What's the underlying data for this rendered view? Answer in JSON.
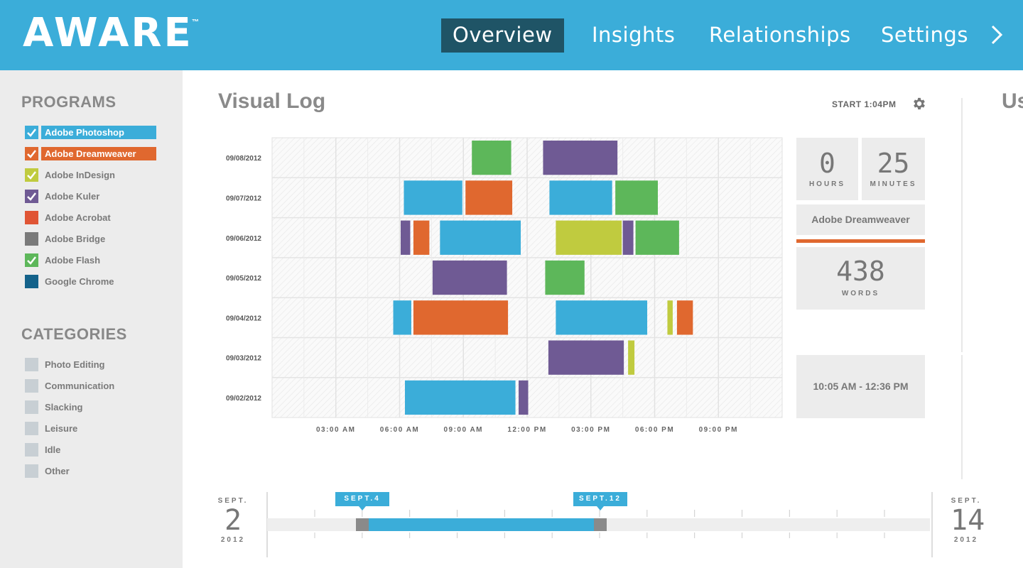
{
  "app": {
    "logo": "AWARE",
    "trademark": "™"
  },
  "nav": [
    {
      "label": "Overview",
      "active": true
    },
    {
      "label": "Insights",
      "active": false
    },
    {
      "label": "Relationships",
      "active": false
    },
    {
      "label": "Settings",
      "active": false
    }
  ],
  "nav_more_icon": "chevron-right-icon",
  "sidebar": {
    "programs_heading": "PROGRAMS",
    "programs": [
      {
        "label": "Adobe Photoshop",
        "color": "#3badd9",
        "checked": true,
        "highlighted": true
      },
      {
        "label": "Adobe Dreamweaver",
        "color": "#e0682f",
        "checked": true,
        "highlighted": true
      },
      {
        "label": "Adobe InDesign",
        "color": "#c0cb3f",
        "checked": true,
        "highlighted": false
      },
      {
        "label": "Adobe Kuler",
        "color": "#6f5a94",
        "checked": true,
        "highlighted": false
      },
      {
        "label": "Adobe Acrobat",
        "color": "#e05535",
        "checked": false,
        "highlighted": false
      },
      {
        "label": "Adobe Bridge",
        "color": "#7a7a7a",
        "checked": false,
        "highlighted": false
      },
      {
        "label": "Adobe Flash",
        "color": "#5db75a",
        "checked": true,
        "highlighted": false
      },
      {
        "label": "Google Chrome",
        "color": "#14628a",
        "checked": false,
        "highlighted": false
      }
    ],
    "categories_heading": "CATEGORIES",
    "categories": [
      "Photo Editing",
      "Communication",
      "Slacking",
      "Leisure",
      "Idle",
      "Other"
    ]
  },
  "main": {
    "title": "Visual Log",
    "start_label": "START 1:04PM",
    "settings_icon": "gear-icon",
    "right_title_partial": "Us"
  },
  "chart_data": {
    "type": "gantt",
    "x_unit": "hour of day",
    "xlim": [
      0,
      24
    ],
    "x_ticks": [
      {
        "value": 3,
        "label": "03:00 AM"
      },
      {
        "value": 6,
        "label": "06:00 AM"
      },
      {
        "value": 9,
        "label": "09:00 AM"
      },
      {
        "value": 12,
        "label": "12:00 PM"
      },
      {
        "value": 15,
        "label": "03:00 PM"
      },
      {
        "value": 18,
        "label": "06:00 PM"
      },
      {
        "value": 21,
        "label": "09:00 PM"
      }
    ],
    "rows": [
      {
        "date": "09/08/2012",
        "segments": [
          {
            "program": "Adobe Flash",
            "start": 9.4,
            "end": 11.25
          },
          {
            "program": "Adobe Kuler",
            "start": 12.75,
            "end": 16.25
          }
        ]
      },
      {
        "date": "09/07/2012",
        "segments": [
          {
            "program": "Adobe Photoshop",
            "start": 6.2,
            "end": 8.95
          },
          {
            "program": "Adobe Dreamweaver",
            "start": 9.1,
            "end": 11.3
          },
          {
            "program": "Adobe Photoshop",
            "start": 13.05,
            "end": 16.0
          },
          {
            "program": "Adobe Flash",
            "start": 16.15,
            "end": 18.15
          }
        ]
      },
      {
        "date": "09/06/2012",
        "segments": [
          {
            "program": "Adobe Kuler",
            "start": 6.05,
            "end": 6.5
          },
          {
            "program": "Adobe Dreamweaver",
            "start": 6.65,
            "end": 7.4
          },
          {
            "program": "Adobe Photoshop",
            "start": 7.9,
            "end": 11.7
          },
          {
            "program": "Adobe InDesign",
            "start": 13.35,
            "end": 16.45
          },
          {
            "program": "Adobe Kuler",
            "start": 16.5,
            "end": 17.0
          },
          {
            "program": "Adobe Flash",
            "start": 17.1,
            "end": 19.15
          }
        ]
      },
      {
        "date": "09/05/2012",
        "segments": [
          {
            "program": "Adobe Kuler",
            "start": 7.55,
            "end": 11.05
          },
          {
            "program": "Adobe Flash",
            "start": 12.85,
            "end": 14.7
          }
        ]
      },
      {
        "date": "09/04/2012",
        "segments": [
          {
            "program": "Adobe Photoshop",
            "start": 5.7,
            "end": 6.55
          },
          {
            "program": "Adobe Dreamweaver",
            "start": 6.65,
            "end": 11.1
          },
          {
            "program": "Adobe Photoshop",
            "start": 13.35,
            "end": 17.65
          },
          {
            "program": "Adobe InDesign",
            "start": 18.6,
            "end": 18.85
          },
          {
            "program": "Adobe Dreamweaver",
            "start": 19.05,
            "end": 19.8
          }
        ]
      },
      {
        "date": "09/03/2012",
        "segments": [
          {
            "program": "Adobe Kuler",
            "start": 13.0,
            "end": 16.55
          },
          {
            "program": "Adobe InDesign",
            "start": 16.75,
            "end": 17.05
          }
        ]
      },
      {
        "date": "09/02/2012",
        "segments": [
          {
            "program": "Adobe Photoshop",
            "start": 6.25,
            "end": 11.45
          },
          {
            "program": "Adobe Kuler",
            "start": 11.6,
            "end": 12.05
          }
        ]
      }
    ]
  },
  "stats": {
    "hours_value": "0",
    "hours_label": "HOURS",
    "minutes_value": "25",
    "minutes_label": "MINUTES",
    "program_name": "Adobe Dreamweaver",
    "program_color": "#e0682f",
    "words_value": "438",
    "words_label": "WORDS",
    "time_range": "10:05 AM - 12:36 PM"
  },
  "timeline": {
    "start_month": "SEPT.",
    "start_day": "2",
    "start_year": "2012",
    "end_month": "SEPT.",
    "end_day": "14",
    "end_year": "2012",
    "range_start_label": "SEPT.4",
    "range_end_label": "SEPT.12",
    "range_start_day": 4,
    "range_end_day": 12,
    "first_day": 2,
    "last_day": 14
  }
}
